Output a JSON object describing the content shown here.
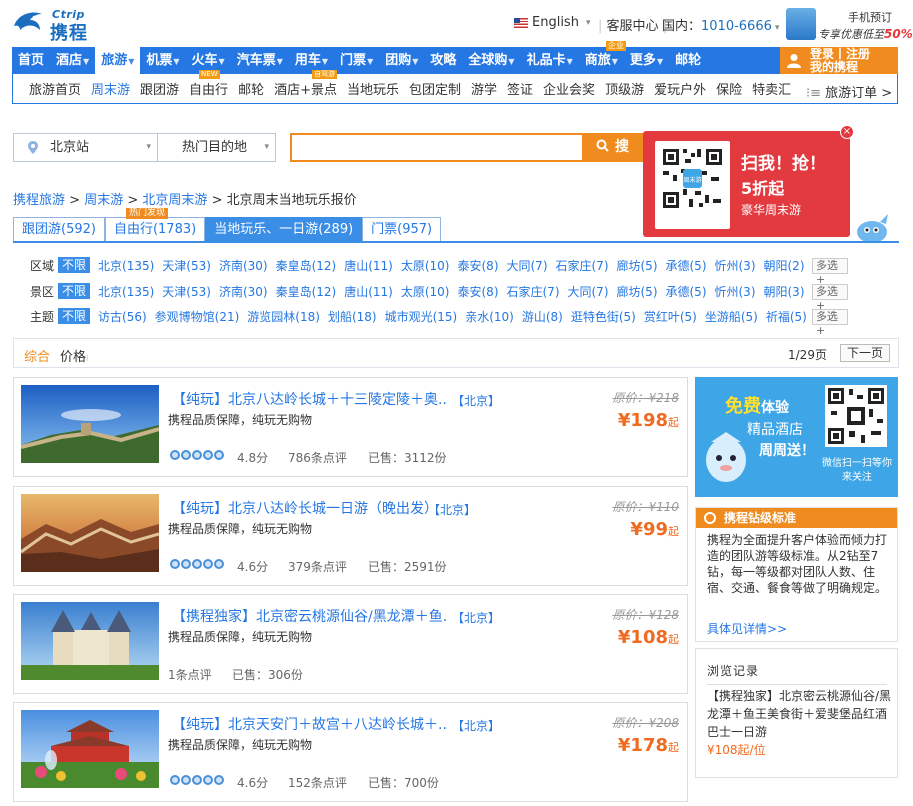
{
  "header": {
    "logo_en": "Ctrip",
    "logo_cn": "携程",
    "language": "English",
    "service": "客服中心",
    "hotline_label": "国内：",
    "hotline_number": "1010-6666",
    "mobile_title": "手机预订",
    "mobile_promo": "专享优惠低至",
    "mobile_promo_value": "50%"
  },
  "nav": {
    "items": [
      {
        "label": "首页"
      },
      {
        "label": "酒店"
      },
      {
        "label": "旅游"
      },
      {
        "label": "机票"
      },
      {
        "label": "火车"
      },
      {
        "label": "汽车票"
      },
      {
        "label": "用车"
      },
      {
        "label": "门票"
      },
      {
        "label": "团购"
      },
      {
        "label": "攻略"
      },
      {
        "label": "全球购"
      },
      {
        "label": "礼品卡"
      },
      {
        "label": "商旅"
      },
      {
        "label": "更多"
      },
      {
        "label": "邮轮"
      }
    ],
    "shanglv_badge": "企业",
    "login_line1": "登录丨注册",
    "login_line2": "我的携程"
  },
  "subnav": {
    "items": [
      {
        "label": "旅游首页"
      },
      {
        "label": "周末游"
      },
      {
        "label": "跟团游"
      },
      {
        "label": "自由行"
      },
      {
        "label": "邮轮"
      },
      {
        "label": "酒店+景点"
      },
      {
        "label": "当地玩乐"
      },
      {
        "label": "包团定制"
      },
      {
        "label": "游学"
      },
      {
        "label": "签证"
      },
      {
        "label": "企业会奖"
      },
      {
        "label": "顶级游"
      },
      {
        "label": "爱玩户外"
      },
      {
        "label": "保险"
      },
      {
        "label": "特卖汇"
      }
    ],
    "new_badge": "NEW",
    "hot_badge": "自驾游",
    "orders": "旅游订单 >"
  },
  "search": {
    "departure": "北京站",
    "destination": "热门目的地",
    "button": "搜"
  },
  "ad": {
    "line1": "扫我！抢！",
    "line2": "5折起",
    "line3": "豪华周末游"
  },
  "breadcrumb": {
    "items": [
      "携程旅游",
      "周末游",
      "北京周末游"
    ],
    "current": "北京周末当地玩乐报价",
    "sep": ">"
  },
  "tabs": [
    {
      "label": "跟团游(592)"
    },
    {
      "label": "自由行(1783)"
    },
    {
      "label": "当地玩乐、一日游(289)"
    },
    {
      "label": "门票(957)"
    }
  ],
  "tab_hot_badge": "热门发现",
  "filters": {
    "all": "不限",
    "multi": "多选+",
    "rows": [
      {
        "label": "区域",
        "options": [
          "北京(135)",
          "天津(53)",
          "济南(30)",
          "秦皇岛(12)",
          "唐山(11)",
          "太原(10)",
          "泰安(8)",
          "大同(7)",
          "石家庄(7)",
          "廊坊(5)",
          "承德(5)",
          "忻州(3)",
          "朝阳(2)"
        ]
      },
      {
        "label": "景区",
        "options": [
          "北京(135)",
          "天津(53)",
          "济南(30)",
          "秦皇岛(12)",
          "唐山(11)",
          "太原(10)",
          "泰安(8)",
          "石家庄(7)",
          "大同(7)",
          "廊坊(5)",
          "承德(5)",
          "忻州(3)",
          "朝阳(3)"
        ]
      },
      {
        "label": "主题",
        "options": [
          "访古(56)",
          "参观博物馆(21)",
          "游览园林(18)",
          "划船(18)",
          "城市观光(15)",
          "亲水(10)",
          "游山(8)",
          "逛特色街(5)",
          "赏红叶(5)",
          "坐游船(5)",
          "祈福(5)"
        ]
      }
    ]
  },
  "sort": {
    "composite": "综合",
    "price": "价格",
    "page": "1/29页",
    "next": "下一页"
  },
  "products": [
    {
      "title": "【纯玩】北京八达岭长城＋十三陵定陵＋奥...",
      "region": "【北京】",
      "feature": "携程品质保障，纯玩无购物",
      "score": "4.8分",
      "reviews": "786条点评",
      "sold": "已售：3112份",
      "orig": "原价：¥218",
      "price": "¥198",
      "qi": "起",
      "has_stars": true
    },
    {
      "title": "【纯玩】北京八达岭长城一日游（晚出发）",
      "region": "【北京】",
      "feature": "携程品质保障，纯玩无购物",
      "score": "4.6分",
      "reviews": "379条点评",
      "sold": "已售：2591份",
      "orig": "原价：¥110",
      "price": "¥99",
      "qi": "起",
      "has_stars": true
    },
    {
      "title": "【携程独家】北京密云桃源仙谷/黑龙潭＋鱼...",
      "region": "【北京】",
      "feature": "携程品质保障，纯玩无购物",
      "score": "",
      "reviews": "1条点评",
      "sold": "已售：306份",
      "orig": "原价：¥128",
      "price": "¥108",
      "qi": "起",
      "has_stars": false
    },
    {
      "title": "【纯玩】北京天安门＋故宫＋八达岭长城＋...",
      "region": "【北京】",
      "feature": "携程品质保障，纯玩无购物",
      "score": "4.6分",
      "reviews": "152条点评",
      "sold": "已售：700份",
      "orig": "原价：¥208",
      "price": "¥178",
      "qi": "起",
      "has_stars": true
    }
  ],
  "promo": {
    "free": "免费",
    "try": "体验",
    "line2": "精品酒店",
    "line3": "周周送！",
    "scan": "微信扫一扫等你来关注"
  },
  "diamond": {
    "title": "携程钻级标准",
    "body": "携程为全面提升客户体验而倾力打造的团队游等级标准。从2钻至7钻，每一等级都对团队人数、住宿、交通、餐食等做了明确规定。",
    "more": "具体见详情>>"
  },
  "history": {
    "title": "浏览记录",
    "item": "【携程独家】北京密云桃源仙谷/黑龙潭＋鱼王美食街＋爱斐堡品红酒巴士一日游",
    "price": "¥108起/位"
  },
  "colors": {
    "brand_blue": "#2577e3",
    "orange": "#f08c1f",
    "price_orange": "#f06b1f"
  }
}
